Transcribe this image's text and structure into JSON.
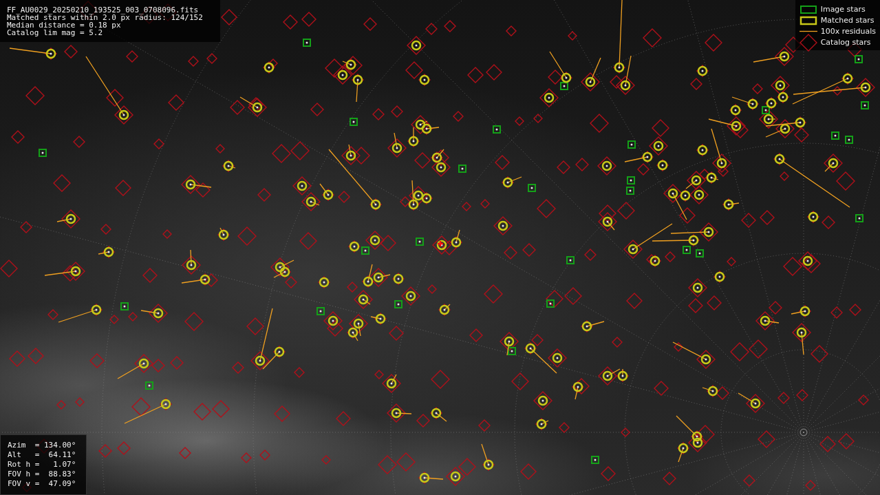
{
  "info_panel": {
    "lines": [
      "FF_AU0029_20250210_193525_003_0708096.fits",
      "Matched stars within 2.0 px radius: 124/152",
      "Median distance = 0.18 px",
      "Catalog lim mag = 5.2"
    ]
  },
  "legend": {
    "items": [
      {
        "label": "Image stars",
        "kind": "image"
      },
      {
        "label": "Matched stars",
        "kind": "matched"
      },
      {
        "label": "100x residuals",
        "kind": "residual"
      },
      {
        "label": "Catalog stars",
        "kind": "catalog"
      }
    ]
  },
  "pointing_panel": {
    "lines": [
      "Azim  = 134.00°",
      "Alt   =  64.11°",
      "Rot h =   1.07°",
      "FOV h =  88.83°",
      "FOV v =  47.09°"
    ]
  }
}
